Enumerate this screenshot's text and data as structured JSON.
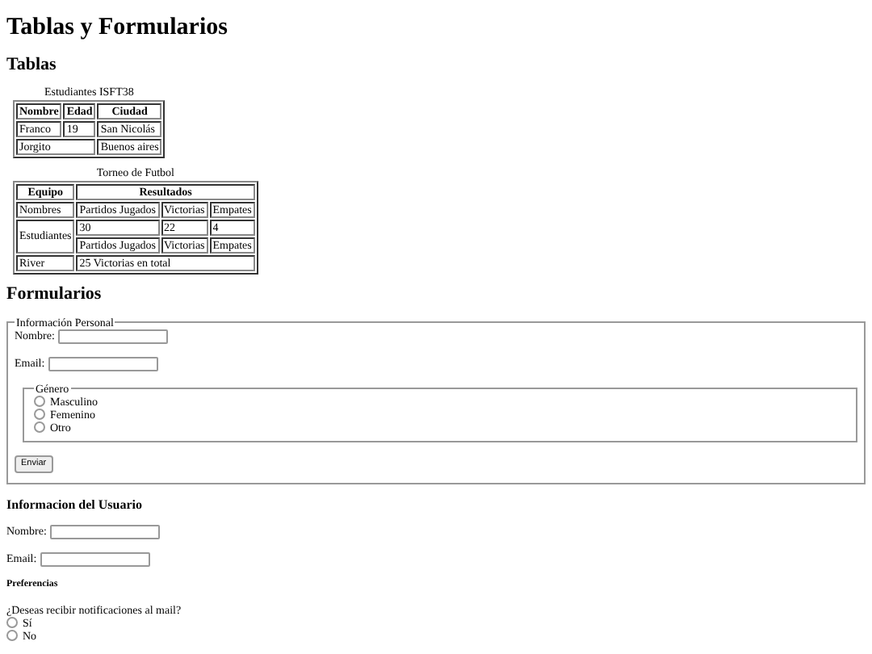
{
  "title": "Tablas y Formularios",
  "tables_section": {
    "heading": "Tablas",
    "tables": [
      {
        "caption": "Estudiantes ISFT38",
        "rows": [
          [
            {
              "text": "Nombre",
              "kind": "header"
            },
            {
              "text": "Edad",
              "kind": "header"
            },
            {
              "text": "Ciudad",
              "kind": "header"
            }
          ],
          [
            {
              "text": "Franco",
              "kind": "data"
            },
            {
              "text": "19",
              "kind": "data"
            },
            {
              "text": "San Nicolás",
              "kind": "data"
            }
          ],
          [
            {
              "text": "Jorgito",
              "kind": "data",
              "colspan": 2
            },
            {
              "text": "Buenos aires",
              "kind": "data"
            }
          ]
        ]
      },
      {
        "caption": "Torneo de Futbol",
        "rows": [
          [
            {
              "text": "Equipo",
              "kind": "header"
            },
            {
              "text": "Resultados",
              "kind": "header",
              "colspan": 3
            }
          ],
          [
            {
              "text": "Nombres",
              "kind": "data"
            },
            {
              "text": "Partidos Jugados",
              "kind": "data"
            },
            {
              "text": "Victorias",
              "kind": "data"
            },
            {
              "text": "Empates",
              "kind": "data"
            }
          ],
          [
            {
              "text": "Estudiantes",
              "kind": "data",
              "rowspan": 2
            },
            {
              "text": "30",
              "kind": "data"
            },
            {
              "text": "22",
              "kind": "data"
            },
            {
              "text": "4",
              "kind": "data"
            }
          ],
          [
            {
              "text": "Partidos Jugados",
              "kind": "data"
            },
            {
              "text": "Victorias",
              "kind": "data"
            },
            {
              "text": "Empates",
              "kind": "data"
            }
          ],
          [
            {
              "text": "River",
              "kind": "data"
            },
            {
              "text": "25 Victorias en total",
              "kind": "data",
              "colspan": 3
            }
          ]
        ]
      }
    ]
  },
  "forms_section": {
    "heading": "Formularios",
    "fieldset": {
      "legend": "Información Personal",
      "fields": [
        {
          "label": "Nombre:"
        },
        {
          "label": "Email:"
        }
      ],
      "gender": {
        "legend": "Género",
        "options": [
          {
            "label": "Masculino",
            "selected": false
          },
          {
            "label": "Femenino",
            "selected": false
          },
          {
            "label": "Otro",
            "selected": false
          }
        ]
      },
      "button": "Enviar"
    }
  },
  "user_section": {
    "heading": "Informacion del Usuario",
    "fields": [
      {
        "label": "Nombre:"
      },
      {
        "label": "Email:"
      }
    ],
    "preferences": {
      "heading": "Preferencias",
      "question": "¿Deseas recibir notificaciones al mail?",
      "options": [
        {
          "label": "Sí",
          "selected": false
        },
        {
          "label": "No",
          "selected": false
        }
      ]
    }
  }
}
